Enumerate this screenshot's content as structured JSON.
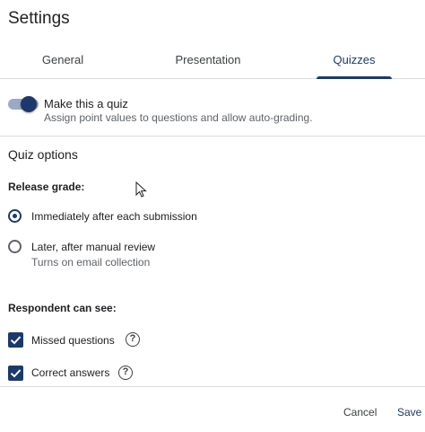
{
  "dialog": {
    "title": "Settings"
  },
  "tabs": [
    {
      "label": "General",
      "active": false
    },
    {
      "label": "Presentation",
      "active": false
    },
    {
      "label": "Quizzes",
      "active": true
    }
  ],
  "quiz_toggle": {
    "label": "Make this a quiz",
    "description": "Assign point values to questions and allow auto-grading.",
    "on": true
  },
  "quiz_options": {
    "section_title": "Quiz options",
    "release_grade": {
      "label": "Release grade:",
      "options": [
        {
          "label": "Immediately after each submission",
          "selected": true
        },
        {
          "label": "Later, after manual review",
          "sublabel": "Turns on email collection",
          "selected": false
        }
      ]
    },
    "respondent": {
      "label": "Respondent can see:",
      "items": [
        {
          "label": "Missed questions",
          "checked": true,
          "help_icon": "?"
        },
        {
          "label": "Correct answers",
          "checked": true,
          "help_icon": "?"
        }
      ]
    }
  },
  "footer": {
    "cancel_label": "Cancel",
    "save_label": "Save"
  },
  "colors": {
    "accent": "#1b3a6b",
    "track": "#9aa9c6",
    "divider": "#dadce0",
    "secondary_text": "#5f6368"
  }
}
